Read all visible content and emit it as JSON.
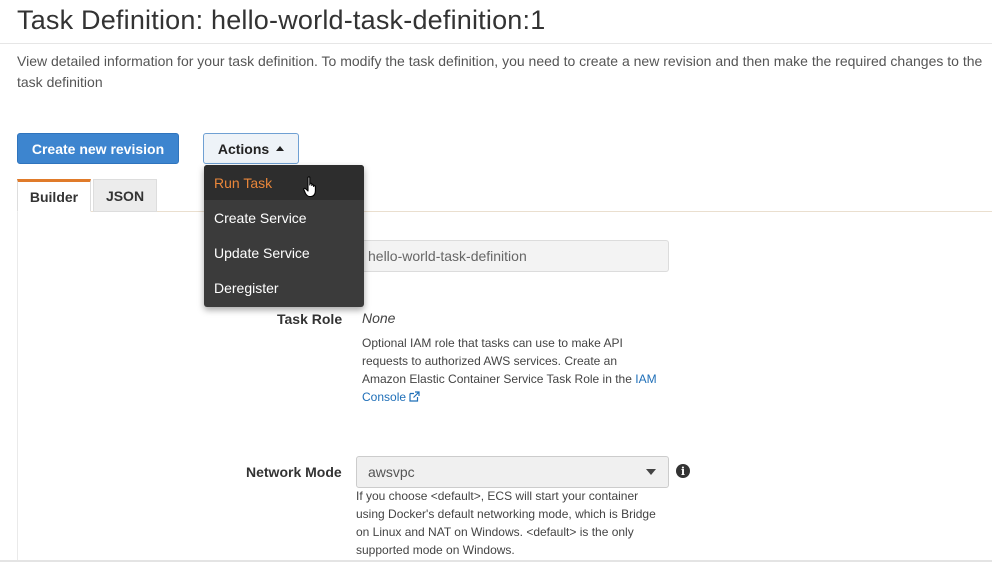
{
  "header": {
    "title": "Task Definition: hello-world-task-definition:1",
    "description": "View detailed information for your task definition. To modify the task definition, you need to create a new revision and then make the required changes to the task definition"
  },
  "toolbar": {
    "create_revision_label": "Create new revision",
    "actions_label": "Actions"
  },
  "actions_menu": {
    "items": [
      {
        "label": "Run Task",
        "active": true
      },
      {
        "label": "Create Service"
      },
      {
        "label": "Update Service"
      },
      {
        "label": "Deregister"
      }
    ]
  },
  "tabs": [
    {
      "label": "Builder",
      "selected": true
    },
    {
      "label": "JSON"
    }
  ],
  "form": {
    "task_definition_name": {
      "value": "hello-world-task-definition"
    },
    "task_role": {
      "label": "Task Role",
      "value": "None",
      "help_text": "Optional IAM role that tasks can use to make API requests to authorized AWS services. Create an Amazon Elastic Container Service Task Role in the",
      "help_link": "IAM Console"
    },
    "network_mode": {
      "label": "Network Mode",
      "value": "awsvpc",
      "help_text": "If you choose <default>, ECS will start your container using Docker's default networking mode, which is Bridge on Linux and NAT on Windows. <default> is the only supported mode on Windows."
    }
  },
  "colors": {
    "primary_button": "#3d85cf",
    "active_tab_accent": "#e07b2a",
    "menu_background": "#3b3b3b",
    "menu_active_text": "#e9863a",
    "link": "#1f6fb8"
  },
  "icons": {
    "actions_caret": "caret-up-icon",
    "external_link": "external-link-icon",
    "select_caret": "caret-down-icon",
    "info": "info-icon",
    "cursor": "hand-pointer-icon"
  }
}
